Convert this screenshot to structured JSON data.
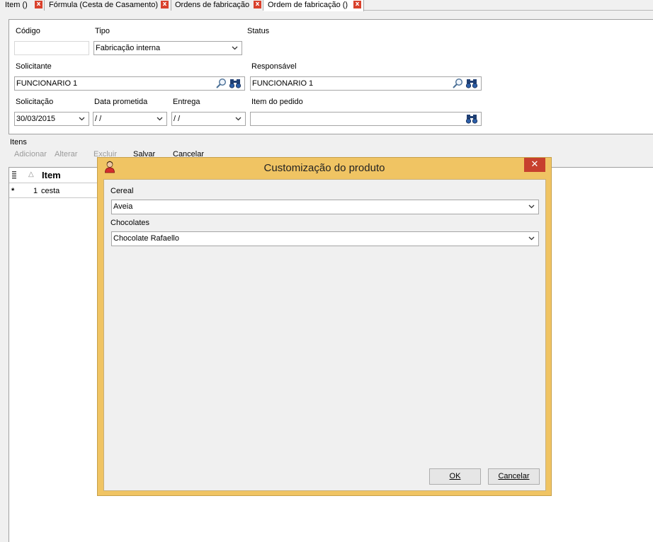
{
  "tabs": [
    {
      "label": "Item ()"
    },
    {
      "label": "Fórmula (Cesta de Casamento)"
    },
    {
      "label": "Ordens de fabricação"
    },
    {
      "label": "Ordem de fabricação ()"
    }
  ],
  "tab_close_glyph": "x",
  "form": {
    "codigo_label": "Código",
    "codigo_value": "",
    "tipo_label": "Tipo",
    "tipo_value": "Fabricação interna",
    "status_label": "Status",
    "solicitante_label": "Solicitante",
    "solicitante_value": "FUNCIONARIO 1",
    "responsavel_label": "Responsável",
    "responsavel_value": "FUNCIONARIO 1",
    "solicitacao_label": "Solicitação",
    "solicitacao_value": "30/03/2015",
    "data_prometida_label": "Data prometida",
    "data_prometida_value": " / /",
    "entrega_label": "Entrega",
    "entrega_value": " / /",
    "item_pedido_label": "Item do pedido",
    "item_pedido_value": ""
  },
  "items": {
    "title": "Itens",
    "toolbar": {
      "adicionar": "Adicionar",
      "alterar": "Alterar",
      "excluir": "Excluir",
      "salvar": "Salvar",
      "cancelar": "Cancelar"
    },
    "grid": {
      "sort_glyph": "△",
      "item_header": "Item",
      "rows": [
        {
          "marker": "*",
          "num": "1",
          "item": "cesta"
        }
      ]
    }
  },
  "dialog": {
    "title": "Customização do produto",
    "close_glyph": "✕",
    "cereal_label": "Cereal",
    "cereal_value": "Aveia",
    "chocolates_label": "Chocolates",
    "chocolates_value": "Chocolate Rafaello",
    "ok_label": "OK",
    "cancel_label": "Cancelar"
  },
  "colors": {
    "dialog_frame": "#f0c463",
    "close_button": "#c7402e",
    "tab_close": "#d9412c"
  }
}
